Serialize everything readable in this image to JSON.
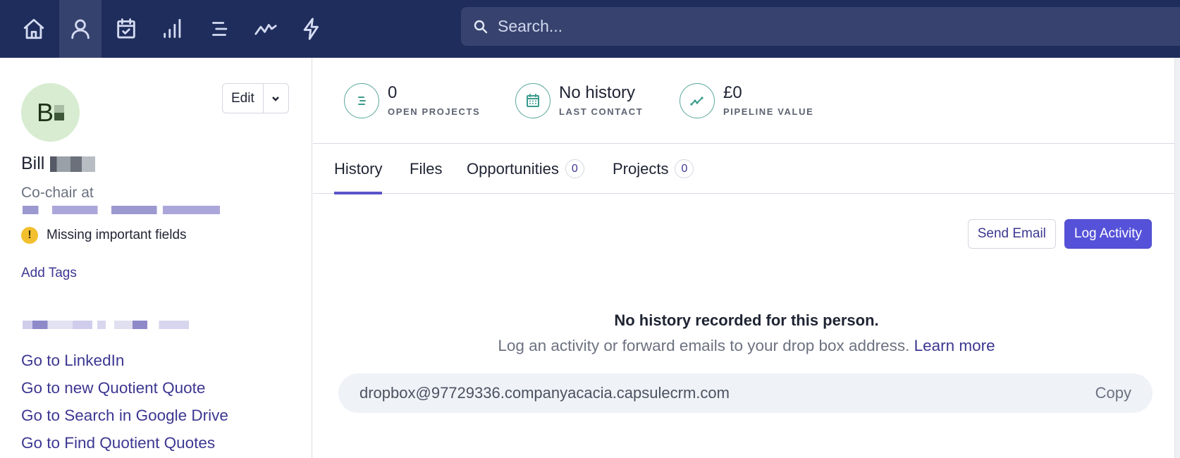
{
  "topnav": {
    "items": [
      {
        "icon": "home-icon",
        "label": "Home",
        "active": false
      },
      {
        "icon": "person-icon",
        "label": "People & Organisations",
        "active": true
      },
      {
        "icon": "calendar-check-icon",
        "label": "Calendar & Tasks",
        "active": false
      },
      {
        "icon": "signal-bars-icon",
        "label": "Sales Pipeline",
        "active": false
      },
      {
        "icon": "list-icon",
        "label": "Projects",
        "active": false
      },
      {
        "icon": "trend-line-icon",
        "label": "Reports",
        "active": false
      },
      {
        "icon": "lightning-icon",
        "label": "Workflow",
        "active": false
      }
    ],
    "search_placeholder": "Search..."
  },
  "contact": {
    "avatar_initial": "B",
    "first_name": "Bill",
    "role": "Co-chair at",
    "edit_label": "Edit",
    "warning": "Missing important fields",
    "add_tags": "Add Tags",
    "links": [
      "Go to LinkedIn",
      "Go to new Quotient Quote",
      "Go to Search in Google Drive",
      "Go to Find Quotient Quotes"
    ]
  },
  "stats": [
    {
      "icon": "projects-icon",
      "value": "0",
      "label": "OPEN PROJECTS"
    },
    {
      "icon": "calendar-icon",
      "value": "No history",
      "label": "LAST CONTACT"
    },
    {
      "icon": "pipeline-icon",
      "value": "£0",
      "label": "PIPELINE VALUE"
    }
  ],
  "tabs": [
    {
      "label": "History",
      "active": true
    },
    {
      "label": "Files"
    },
    {
      "label": "Opportunities",
      "count": "0"
    },
    {
      "label": "Projects",
      "count": "0"
    }
  ],
  "actions": {
    "send_email": "Send Email",
    "log_activity": "Log Activity"
  },
  "empty_state": {
    "title": "No history recorded for this person.",
    "subtitle": "Log an activity or forward emails to your drop box address.",
    "learn_more": "Learn more"
  },
  "dropbox": {
    "address": "dropbox@97729336.companyacacia.capsulecrm.com",
    "copy_label": "Copy"
  },
  "colors": {
    "nav_bg": "#1f2d5c",
    "accent": "#5552d9",
    "link": "#3c3791",
    "stat_icon": "#3a9b8d",
    "warning": "#f2c02f"
  }
}
